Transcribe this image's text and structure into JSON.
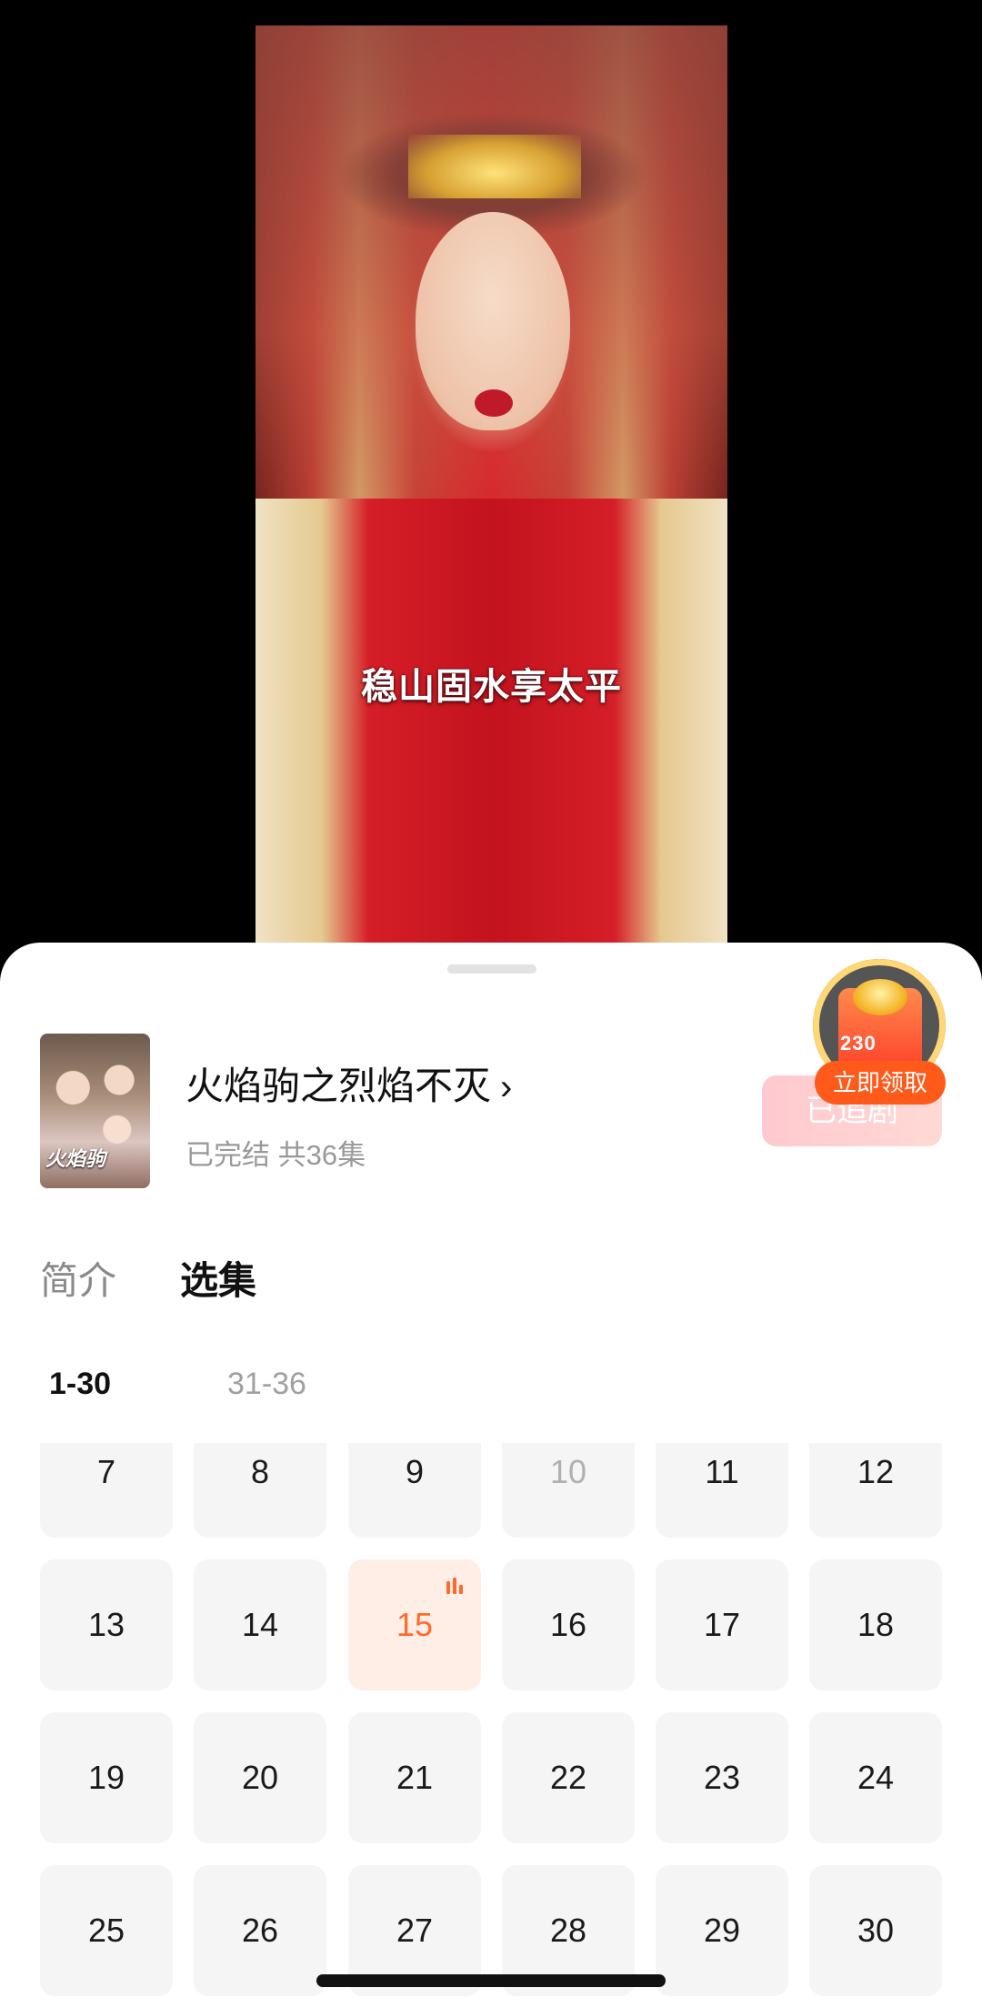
{
  "video": {
    "subtitle": "稳山固水享太平"
  },
  "drama": {
    "title": "火焰驹之烈焰不灭",
    "meta": "已完结 共36集",
    "poster_text": "火焰驹"
  },
  "follow_button": "已追剧",
  "reward": {
    "label": "立即领取",
    "badge_number": "230"
  },
  "tabs": {
    "intro": "简介",
    "episodes": "选集"
  },
  "ranges": [
    "1-30",
    "31-36"
  ],
  "episodes": [
    "7",
    "8",
    "9",
    "10",
    "11",
    "12",
    "13",
    "14",
    "15",
    "16",
    "17",
    "18",
    "19",
    "20",
    "21",
    "22",
    "23",
    "24",
    "25",
    "26",
    "27",
    "28",
    "29",
    "30"
  ],
  "current_episode": "15",
  "dimmed_episode": "10",
  "colors": {
    "accent": "#ff6a2b",
    "reward": "#ff5a1a"
  }
}
